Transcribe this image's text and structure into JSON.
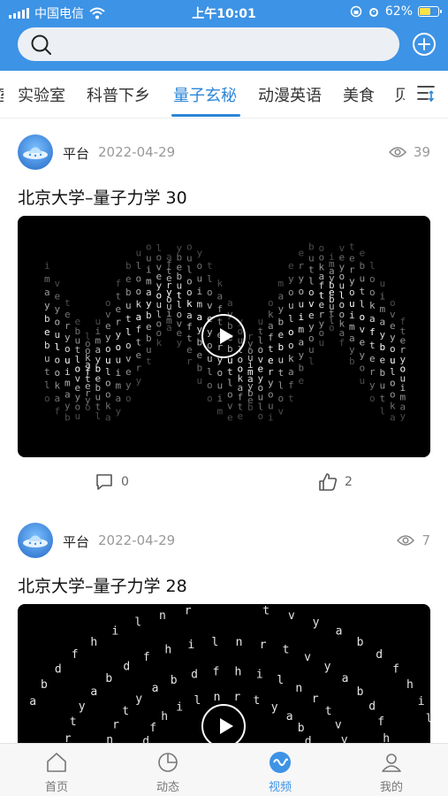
{
  "status_bar": {
    "carrier": "中国电信",
    "time": "上午10:01",
    "battery_percent": "62%",
    "battery_level": 0.62
  },
  "search": {
    "placeholder": ""
  },
  "tabs": [
    {
      "label": "实验室",
      "active": false
    },
    {
      "label": "科普下乡",
      "active": false
    },
    {
      "label": "量子玄秘",
      "active": true
    },
    {
      "label": "动漫英语",
      "active": false
    },
    {
      "label": "美食",
      "active": false
    }
  ],
  "feed": [
    {
      "author": "平台",
      "date": "2022-04-29",
      "views": "39",
      "title": "北京大学–量子力学 30",
      "comments": "0",
      "likes": "2"
    },
    {
      "author": "平台",
      "date": "2022-04-29",
      "views": "7",
      "title": "北京大学–量子力学 28"
    }
  ],
  "bottom_nav": [
    {
      "label": "首页",
      "icon": "home-icon"
    },
    {
      "label": "动态",
      "icon": "pie-chart-icon"
    },
    {
      "label": "视频",
      "icon": "video-icon",
      "active": true
    },
    {
      "label": "我的",
      "icon": "user-icon"
    }
  ],
  "colors": {
    "header": "#3d93e5",
    "accent": "#2c86d6",
    "battery_fill": "#ffe14a"
  }
}
